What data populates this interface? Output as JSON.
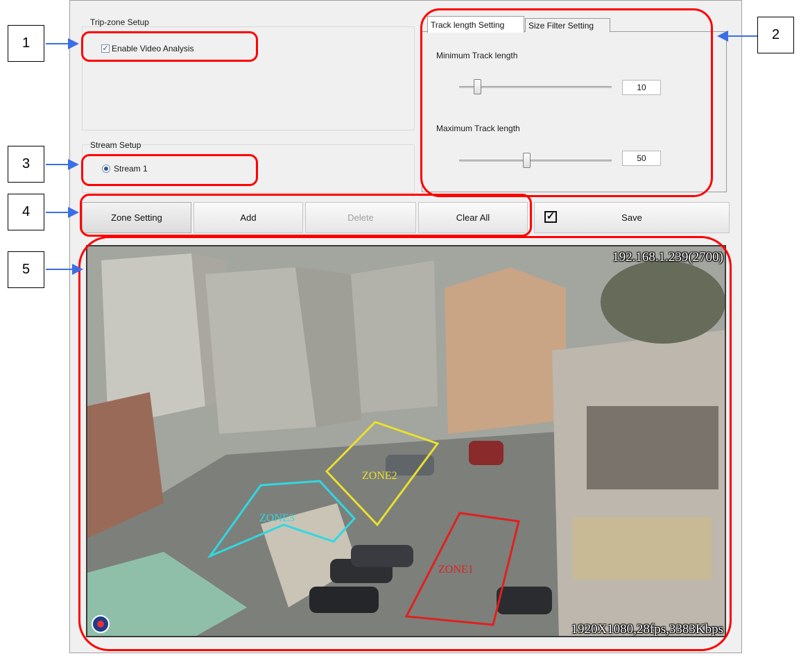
{
  "trip_zone": {
    "title": "Trip-zone Setup",
    "enable_label": "Enable Video Analysis",
    "enable_checked": true
  },
  "stream_setup": {
    "title": "Stream Setup",
    "stream_label": "Stream 1",
    "stream_selected": true
  },
  "tabs": [
    {
      "label": "Track length Setting",
      "active": true
    },
    {
      "label": "Size Filter Setting",
      "active": false
    }
  ],
  "track_length": {
    "min_label": "Minimum Track length",
    "min_value": "10",
    "max_label": "Maximum Track length",
    "max_value": "50"
  },
  "buttons": {
    "zone_setting": "Zone Setting",
    "add": "Add",
    "delete": "Delete",
    "clear_all": "Clear All",
    "save": "Save"
  },
  "video": {
    "ip_overlay": "192.168.1.239(2700)",
    "stats_overlay": "1920X1080,28fps,3383Kbps",
    "zones": [
      {
        "name": "ZONE1",
        "color": "#e02020"
      },
      {
        "name": "ZONE2",
        "color": "#e8e030"
      },
      {
        "name": "ZONE3",
        "color": "#30d8e0"
      }
    ]
  },
  "callouts": [
    "1",
    "2",
    "3",
    "4",
    "5"
  ],
  "colors": {
    "highlight": "#ff0000",
    "arrow": "#3b6fe6",
    "panel_bg": "#f0f0f0"
  }
}
